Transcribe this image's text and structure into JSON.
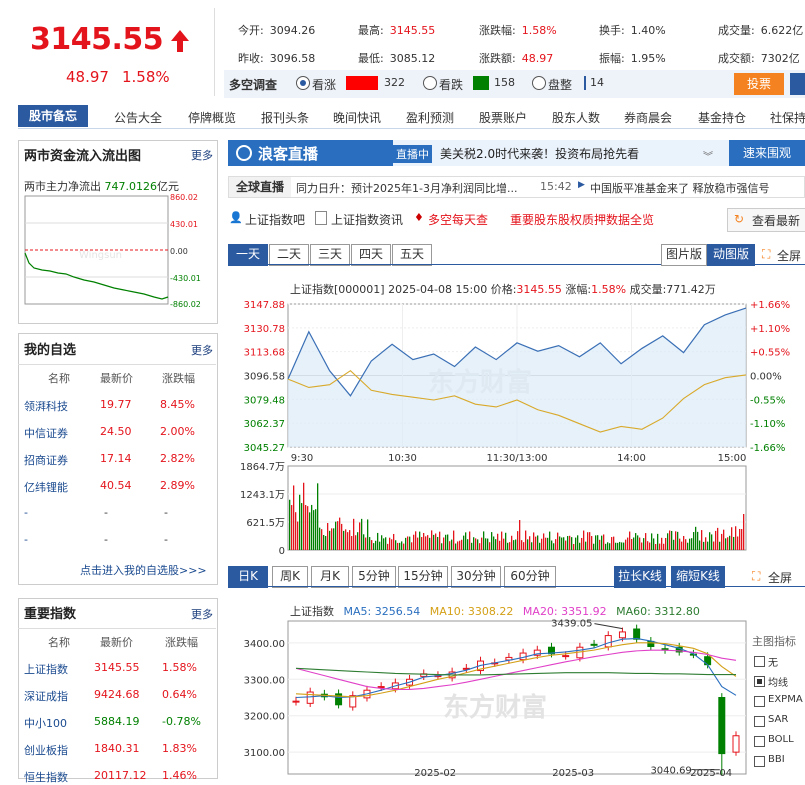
{
  "quote": {
    "price": "3145.55",
    "change": "48.97",
    "change_pct": "1.58%",
    "stats": [
      {
        "label": "今开:",
        "value": "3094.26"
      },
      {
        "label": "最高:",
        "value": "3145.55"
      },
      {
        "label": "涨跌幅:",
        "value": "1.58%"
      },
      {
        "label": "换手:",
        "value": "1.40%"
      },
      {
        "label": "成交量:",
        "value": "6.622亿"
      },
      {
        "label": "昨收:",
        "value": "3096.58"
      },
      {
        "label": "最低:",
        "value": "3085.12"
      },
      {
        "label": "涨跌额:",
        "value": "48.97"
      },
      {
        "label": "振幅:",
        "value": "1.95%"
      },
      {
        "label": "成交额:",
        "value": "7302亿"
      }
    ],
    "survey": {
      "title": "多空调查",
      "options": [
        "看涨",
        "看跌",
        "盘整"
      ],
      "bull_count": "322",
      "bear_count": "158",
      "flat_count": "14",
      "vote_button": "投票"
    },
    "colors": {
      "up": "#e4141c",
      "down": "#008000",
      "accent": "#2b5aa1",
      "orange": "#f58220"
    }
  },
  "nav": {
    "head": "股市备忘",
    "items": [
      "公告大全",
      "停牌概览",
      "报刊头条",
      "晚间快讯",
      "盈利预测",
      "股票账户",
      "股东人数",
      "券商晨会",
      "基金持仓",
      "社保持"
    ]
  },
  "flow": {
    "title": "两市资金流入流出图",
    "more": "更多",
    "summary_label": "两市主力净流出",
    "summary_value": "747.0126",
    "summary_unit": "亿元",
    "yticks": [
      "860.02",
      "430.01",
      "0.00",
      "-430.01",
      "-860.02"
    ],
    "watermark": "Wingsun"
  },
  "watchlist": {
    "title": "我的自选",
    "more": "更多",
    "headers": [
      "名称",
      "最新价",
      "涨跌幅"
    ],
    "rows": [
      {
        "name": "领湃科技",
        "price": "19.77",
        "pct": "8.45%"
      },
      {
        "name": "中信证券",
        "price": "24.50",
        "pct": "2.00%"
      },
      {
        "name": "招商证券",
        "price": "17.14",
        "pct": "2.82%"
      },
      {
        "name": "亿纬锂能",
        "price": "40.54",
        "pct": "2.89%"
      },
      {
        "name": "-",
        "price": "-",
        "pct": "-"
      },
      {
        "name": "-",
        "price": "-",
        "pct": "-"
      }
    ],
    "link": "点击进入我的自选股>>>"
  },
  "indices": {
    "title": "重要指数",
    "more": "更多",
    "headers": [
      "名称",
      "最新价",
      "涨跌幅"
    ],
    "rows": [
      {
        "name": "上证指数",
        "price": "3145.55",
        "pct": "1.58%",
        "dir": "up"
      },
      {
        "name": "深证成指",
        "price": "9424.68",
        "pct": "0.64%",
        "dir": "up"
      },
      {
        "name": "中小100",
        "price": "5884.19",
        "pct": "-0.78%",
        "dir": "down"
      },
      {
        "name": "创业板指",
        "price": "1840.31",
        "pct": "1.83%",
        "dir": "up"
      },
      {
        "name": "恒生指数",
        "price": "20117.12",
        "pct": "1.46%",
        "dir": "up"
      }
    ]
  },
  "live": {
    "brand": "浪客直播",
    "tag": "直播中",
    "headline": "美关税2.0时代来袭！投资布局抢先看",
    "cta": "速来围观>>>",
    "ticker_label": "全球直播",
    "ticker_text": "同力日升：预计2025年1-3月净利润同比增...",
    "ticker_time": "15:42",
    "ticker_text2": "中国版平准基金来了 释放稳市强信号"
  },
  "links": {
    "items": [
      "上证指数吧",
      "上证指数资讯",
      "多空每天查",
      "重要股东股权质押数据全览"
    ],
    "refresh": "查看最新"
  },
  "intraday": {
    "period_tabs": [
      "一天",
      "二天",
      "三天",
      "四天",
      "五天"
    ],
    "view_tabs": [
      "图片版",
      "动图版"
    ],
    "fullscreen": "全屏",
    "info_line": "上证指数[000001]  2025-04-08 15:00  价格:",
    "info_price": "3145.55",
    "info_pct_label": "涨幅:",
    "info_pct": "1.58%",
    "info_vol": "成交量:771.42万",
    "watermark": "东方财富"
  },
  "kline": {
    "tabs": [
      "日K",
      "周K",
      "月K",
      "5分钟",
      "15分钟",
      "30分钟",
      "60分钟"
    ],
    "right_tabs": [
      "拉长K线",
      "缩短K线"
    ],
    "fullscreen": "全屏",
    "legend": {
      "name": "上证指数",
      "ma5": "MA5: 3256.54",
      "ma10": "MA10: 3308.22",
      "ma20": "MA20: 3351.92",
      "ma60": "MA60: 3312.80"
    },
    "yticks": [
      "3400.00",
      "3300.00",
      "3200.00",
      "3100.00"
    ],
    "high_label": "3439.05",
    "low_label": "3040.69",
    "xticks": [
      "2025-02",
      "2025-03",
      "2025-04"
    ],
    "indicator_title": "主图指标",
    "indicators": [
      "无",
      "均线",
      "EXPMA",
      "SAR",
      "BOLL",
      "BBI"
    ],
    "indicator_checked": "均线",
    "watermark": "东方财富"
  },
  "chart_data": [
    {
      "type": "line",
      "title": "上证指数[000001] 分时",
      "x": [
        "9:30",
        "10:30",
        "11:30/13:00",
        "14:00",
        "15:00"
      ],
      "ylim": [
        3045.27,
        3147.88
      ],
      "yticks": [
        "3147.88",
        "3130.78",
        "3113.68",
        "3096.58",
        "3079.48",
        "3062.37",
        "3045.27"
      ],
      "y2ticks": [
        "+1.66%",
        "+1.10%",
        "+0.55%",
        "0.00%",
        "-0.55%",
        "-1.10%",
        "-1.66%"
      ],
      "volume_ticks": [
        "1864.7万",
        "1243.1万",
        "621.5万",
        "0"
      ],
      "series": [
        {
          "name": "price",
          "values": [
            3094,
            3128,
            3100,
            3082,
            3107,
            3119,
            3108,
            3112,
            3103,
            3117,
            3108,
            3120,
            3114,
            3118,
            3110,
            3120,
            3105,
            3116,
            3125,
            3113,
            3133,
            3140,
            3145
          ]
        },
        {
          "name": "avg",
          "values": [
            3094,
            3088,
            3090,
            3100,
            3086,
            3083,
            3081,
            3079,
            3082,
            3076,
            3074,
            3079,
            3072,
            3068,
            3062,
            3056,
            3060,
            3058,
            3066,
            3080,
            3090,
            3095,
            3097
          ]
        }
      ]
    },
    {
      "type": "line",
      "title": "上证指数 日K",
      "x": [
        "2025-02",
        "2025-03",
        "2025-04"
      ],
      "ylim": [
        3040,
        3460
      ],
      "yticks": [
        "3400.00",
        "3300.00",
        "3200.00",
        "3100.00"
      ],
      "series": [
        {
          "name": "close",
          "values": [
            3240,
            3265,
            3252,
            3230,
            3255,
            3270,
            3280,
            3290,
            3300,
            3315,
            3310,
            3320,
            3330,
            3350,
            3345,
            3360,
            3372,
            3380,
            3370,
            3365,
            3388,
            3395,
            3420,
            3430,
            3410,
            3390,
            3380,
            3375,
            3368,
            3340,
            3096,
            3145
          ]
        },
        {
          "name": "MA5",
          "values": [
            3250,
            3252,
            3255,
            3250,
            3252,
            3260,
            3270,
            3282,
            3292,
            3306,
            3310,
            3316,
            3325,
            3338,
            3345,
            3352,
            3360,
            3370,
            3372,
            3375,
            3380,
            3386,
            3400,
            3410,
            3412,
            3405,
            3395,
            3385,
            3370,
            3340,
            3280,
            3256
          ]
        },
        {
          "name": "MA10",
          "values": [
            3260,
            3258,
            3256,
            3254,
            3252,
            3255,
            3262,
            3270,
            3280,
            3290,
            3300,
            3308,
            3318,
            3328,
            3336,
            3344,
            3352,
            3360,
            3366,
            3370,
            3375,
            3380,
            3388,
            3395,
            3400,
            3400,
            3398,
            3392,
            3385,
            3370,
            3335,
            3308
          ]
        },
        {
          "name": "MA20",
          "values": [
            3330,
            3320,
            3310,
            3300,
            3290,
            3280,
            3275,
            3272,
            3272,
            3275,
            3280,
            3285,
            3292,
            3300,
            3308,
            3316,
            3324,
            3332,
            3340,
            3348,
            3355,
            3362,
            3368,
            3374,
            3378,
            3380,
            3380,
            3378,
            3374,
            3368,
            3358,
            3352
          ]
        },
        {
          "name": "MA60",
          "values": [
            3330,
            3328,
            3326,
            3324,
            3322,
            3320,
            3318,
            3316,
            3315,
            3314,
            3313,
            3312,
            3312,
            3312,
            3313,
            3314,
            3315,
            3316,
            3317,
            3318,
            3318,
            3318,
            3318,
            3317,
            3316,
            3316,
            3315,
            3315,
            3314,
            3313,
            3313,
            3313
          ]
        }
      ]
    }
  ]
}
